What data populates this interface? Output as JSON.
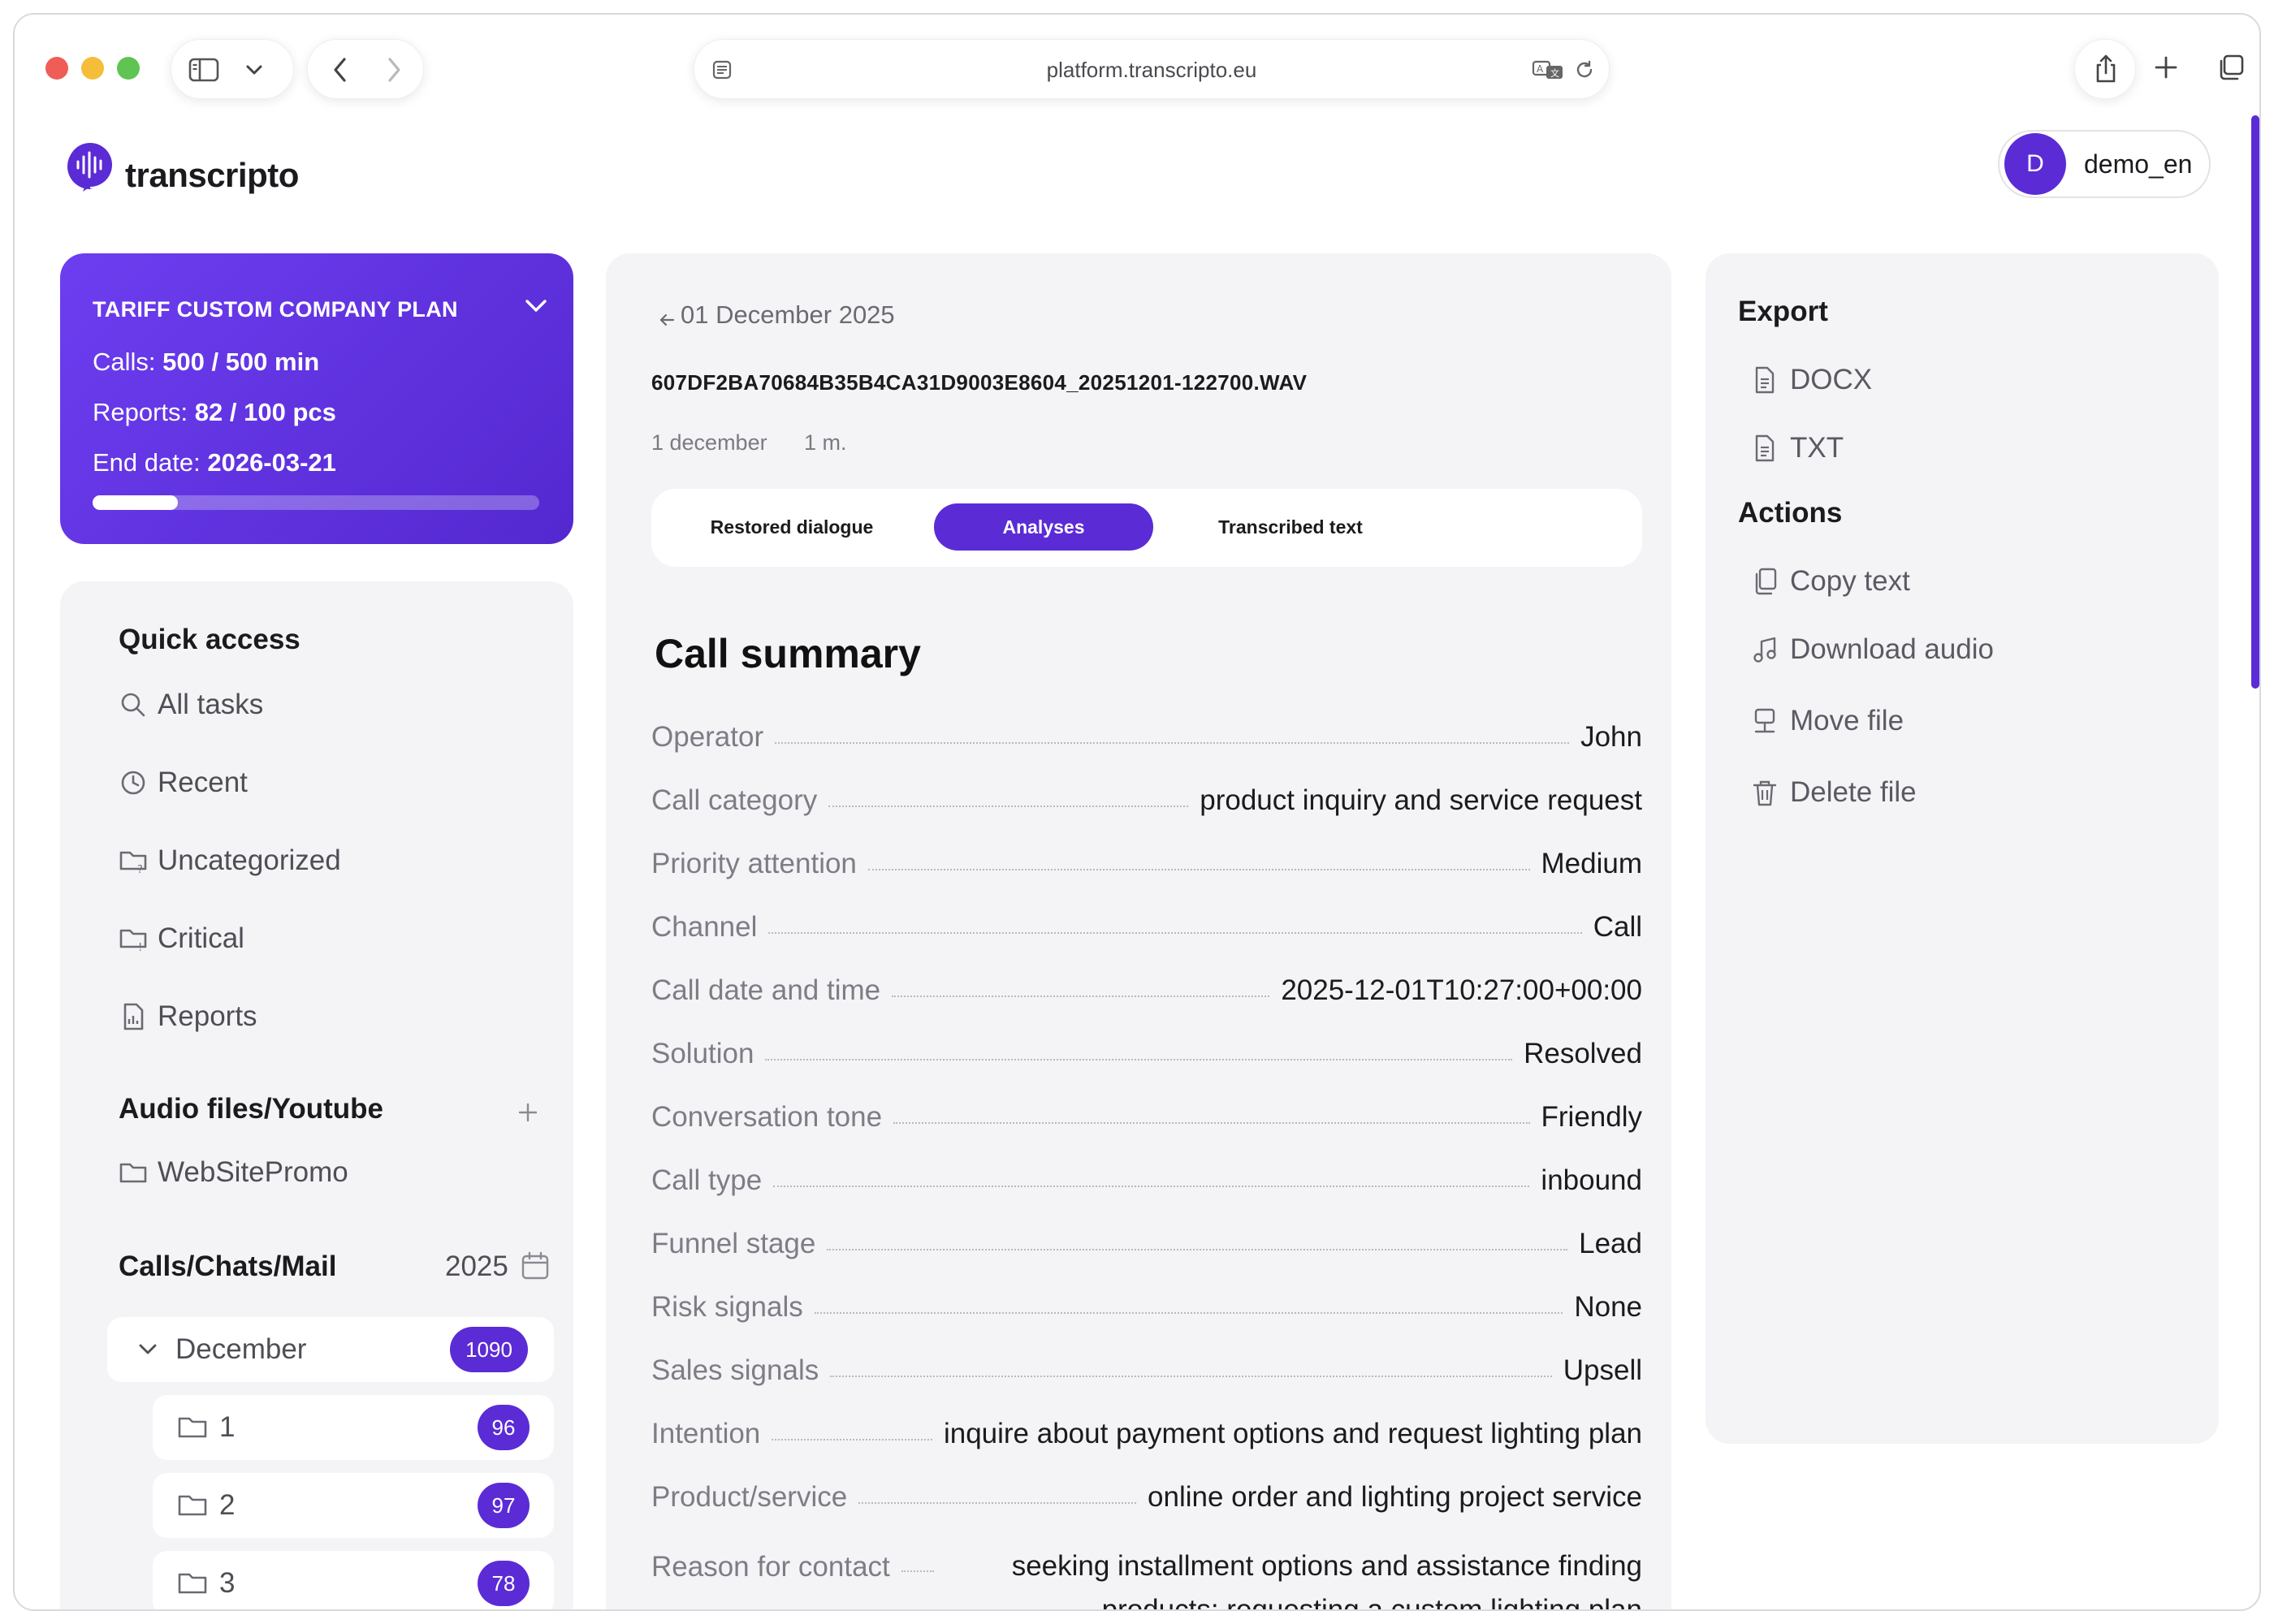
{
  "browser": {
    "url": "platform.transcripto.eu"
  },
  "app": {
    "logo_text": "transcripto",
    "user": {
      "initial": "D",
      "name": "demo_en"
    }
  },
  "plan": {
    "title": "TARIFF CUSTOM COMPANY PLAN",
    "calls_label": "Calls:",
    "calls_value": "500 / 500 min",
    "reports_label": "Reports:",
    "reports_value": "82 / 100 pcs",
    "end_label": "End date:",
    "end_value": "2026-03-21",
    "progress": 0.19
  },
  "sidebar": {
    "quick_access_title": "Quick access",
    "quick_items": [
      {
        "label": "All tasks",
        "icon": "search-icon"
      },
      {
        "label": "Recent",
        "icon": "clock-icon"
      },
      {
        "label": "Uncategorized",
        "icon": "folder-question-icon"
      },
      {
        "label": "Critical",
        "icon": "folder-alert-icon"
      },
      {
        "label": "Reports",
        "icon": "report-icon"
      }
    ],
    "audio_title": "Audio files/Youtube",
    "audio_items": [
      {
        "label": "WebSitePromo",
        "icon": "folder-icon"
      }
    ],
    "calls_title": "Calls/Chats/Mail",
    "year": "2025",
    "month": {
      "label": "December",
      "count": "1090"
    },
    "days": [
      {
        "label": "1",
        "count": "96"
      },
      {
        "label": "2",
        "count": "97"
      },
      {
        "label": "3",
        "count": "78"
      }
    ]
  },
  "file": {
    "back_date": "01 December 2025",
    "name": "607DF2BA70684B35B4CA31D9003E8604_20251201-122700.WAV",
    "date": "1 december",
    "duration": "1 m.",
    "tabs": [
      "Restored dialogue",
      "Analyses",
      "Transcribed text"
    ],
    "active_tab": "Analyses"
  },
  "summary": {
    "title": "Call summary",
    "rows": [
      {
        "key": "Operator",
        "value": "John"
      },
      {
        "key": "Call category",
        "value": "product inquiry and service request"
      },
      {
        "key": "Priority attention",
        "value": "Medium"
      },
      {
        "key": "Channel",
        "value": "Call"
      },
      {
        "key": "Call date and time",
        "value": "2025-12-01T10:27:00+00:00"
      },
      {
        "key": "Solution",
        "value": "Resolved"
      },
      {
        "key": "Conversation tone",
        "value": "Friendly"
      },
      {
        "key": "Call type",
        "value": "inbound"
      },
      {
        "key": "Funnel stage",
        "value": "Lead"
      },
      {
        "key": "Risk signals",
        "value": "None"
      },
      {
        "key": "Sales signals",
        "value": "Upsell"
      },
      {
        "key": "Intention",
        "value": "inquire about payment options and request lighting plan"
      },
      {
        "key": "Product/service",
        "value": "online order and lighting project service"
      },
      {
        "key": "Reason for contact",
        "value": "seeking installment options and assistance finding products; requesting a custom lighting plan"
      }
    ]
  },
  "right_panel": {
    "export_title": "Export",
    "export_items": [
      {
        "label": "DOCX",
        "icon": "document-icon"
      },
      {
        "label": "TXT",
        "icon": "document-icon"
      }
    ],
    "actions_title": "Actions",
    "action_items": [
      {
        "label": "Copy text",
        "icon": "copy-icon"
      },
      {
        "label": "Download audio",
        "icon": "music-note-icon"
      },
      {
        "label": "Move file",
        "icon": "move-icon"
      },
      {
        "label": "Delete file",
        "icon": "trash-icon"
      }
    ]
  },
  "colors": {
    "accent": "#5b2bd6",
    "panel": "#f4f4f7"
  }
}
